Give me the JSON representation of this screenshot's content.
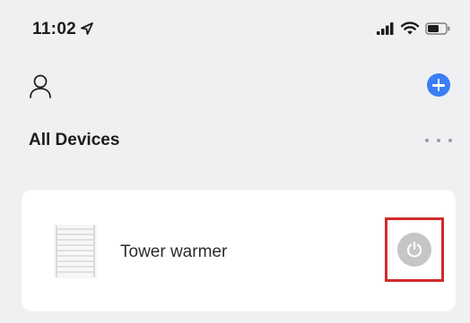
{
  "status_bar": {
    "time": "11:02",
    "icons": [
      "location-arrow-icon",
      "signal-icon",
      "wifi-icon",
      "battery-icon"
    ]
  },
  "header": {
    "profile_icon": "user-icon",
    "add_icon": "plus-icon",
    "accent_color": "#3a7ff6"
  },
  "section": {
    "title": "All Devices",
    "more_icon": "ellipsis-icon"
  },
  "devices": [
    {
      "name": "Tower warmer",
      "image_icon": "towel-warmer-icon",
      "power_state": "off",
      "power_icon": "power-icon",
      "highlighted": true,
      "highlight_color": "#d42a2a"
    }
  ]
}
